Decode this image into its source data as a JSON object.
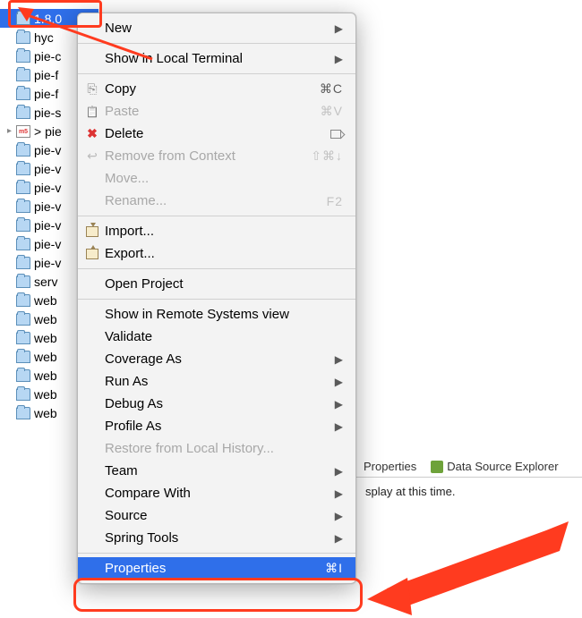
{
  "tree": {
    "items": [
      {
        "label": "1.8.0",
        "type": "folder",
        "selected": true
      },
      {
        "label": "hyc",
        "type": "folder"
      },
      {
        "label": "pie-c",
        "type": "folder"
      },
      {
        "label": "pie-f",
        "type": "folder"
      },
      {
        "label": "pie-f",
        "type": "folder"
      },
      {
        "label": "pie-s",
        "type": "folder"
      },
      {
        "label": "> pie",
        "type": "mvn",
        "expandable": true
      },
      {
        "label": "pie-v",
        "type": "folder"
      },
      {
        "label": "pie-v",
        "type": "folder"
      },
      {
        "label": "pie-v",
        "type": "folder"
      },
      {
        "label": "pie-v",
        "type": "folder"
      },
      {
        "label": "pie-v",
        "type": "folder"
      },
      {
        "label": "pie-v",
        "type": "folder"
      },
      {
        "label": "pie-v",
        "type": "folder"
      },
      {
        "label": "serv",
        "type": "folder"
      },
      {
        "label": "web",
        "type": "folder"
      },
      {
        "label": "web",
        "type": "folder"
      },
      {
        "label": "web",
        "type": "folder"
      },
      {
        "label": "web",
        "type": "folder"
      },
      {
        "label": "web",
        "type": "folder"
      },
      {
        "label": "web",
        "type": "folder"
      },
      {
        "label": "web",
        "type": "folder"
      }
    ]
  },
  "menu": {
    "new": "New",
    "show_terminal": "Show in Local Terminal",
    "copy": "Copy",
    "copy_sc": "⌘C",
    "paste": "Paste",
    "paste_sc": "⌘V",
    "delete": "Delete",
    "delete_sc": "⌦",
    "remove_ctx": "Remove from Context",
    "remove_ctx_sc": "⇧⌘↓",
    "move": "Move...",
    "rename": "Rename...",
    "rename_sc": "F2",
    "import": "Import...",
    "export": "Export...",
    "open_project": "Open Project",
    "show_remote": "Show in Remote Systems view",
    "validate": "Validate",
    "coverage_as": "Coverage As",
    "run_as": "Run As",
    "debug_as": "Debug As",
    "profile_as": "Profile As",
    "restore_history": "Restore from Local History...",
    "team": "Team",
    "compare_with": "Compare With",
    "source": "Source",
    "spring_tools": "Spring Tools",
    "properties": "Properties",
    "properties_sc": "⌘I"
  },
  "panel": {
    "tab_properties": "Properties",
    "tab_ds_explorer": "Data Source Explorer",
    "message": "splay at this time."
  }
}
